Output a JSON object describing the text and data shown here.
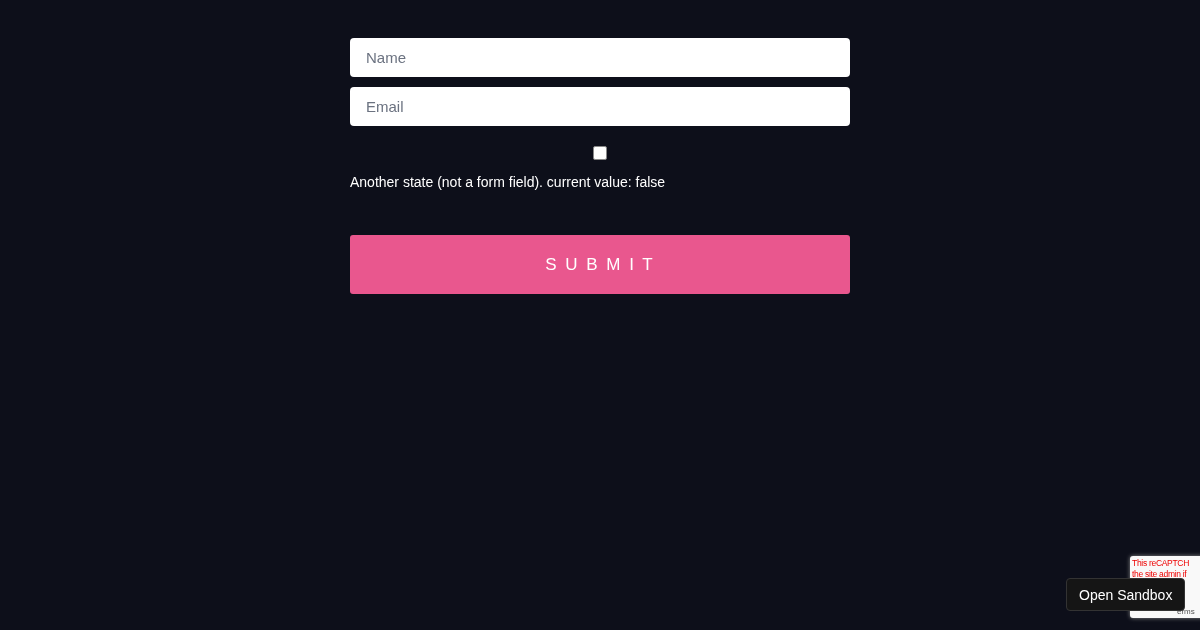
{
  "form": {
    "fields": [
      {
        "placeholder": "Name"
      },
      {
        "placeholder": "Email"
      }
    ],
    "toggle": {
      "checked": false
    },
    "state_text": "Another state (not a form field). current value: false",
    "submit": "S U B M I T"
  },
  "recaptcha_badge": {
    "lines": [
      "This reCAPTCH",
      "the site admin if"
    ],
    "terms": "erms"
  },
  "sandbox_button": "Open Sandbox"
}
